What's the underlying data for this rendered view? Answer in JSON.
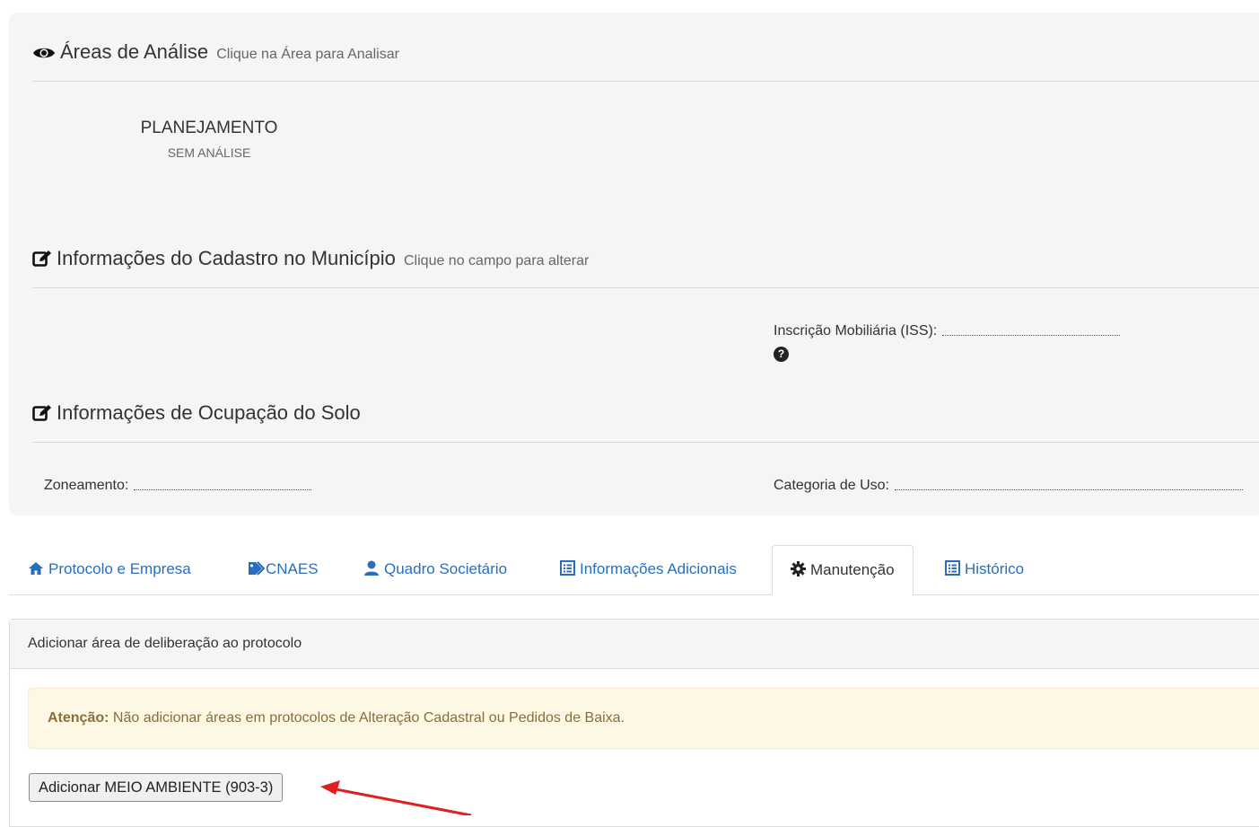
{
  "areas_section": {
    "icon": "eye-icon",
    "title": "Áreas de Análise",
    "subtitle": "Clique na Área para Analisar",
    "areas": [
      {
        "name": "PLANEJAMENTO",
        "status": "SEM ANÁLISE"
      }
    ]
  },
  "cadastro_section": {
    "icon": "edit-icon",
    "title": "Informações do Cadastro no Município",
    "subtitle": "Clique no campo para alterar",
    "inscricao_label": "Inscrição Mobiliária (ISS):",
    "inscricao_value": "",
    "help_icon": "question-circle-icon",
    "help_glyph": "?"
  },
  "solo_section": {
    "icon": "edit-icon",
    "title": "Informações de Ocupação do Solo",
    "zoneamento_label": "Zoneamento:",
    "zoneamento_value": "",
    "categoria_label": "Categoria de Uso:",
    "categoria_value": ""
  },
  "tabs": [
    {
      "label": "Protocolo e Empresa",
      "icon": "home-icon",
      "active": false
    },
    {
      "label": "CNAES",
      "icon": "tags-icon",
      "active": false
    },
    {
      "label": "Quadro Societário",
      "icon": "user-icon",
      "active": false
    },
    {
      "label": "Informações Adicionais",
      "icon": "list-alt-icon",
      "active": false
    },
    {
      "label": "Manutenção",
      "icon": "cog-icon",
      "active": true
    },
    {
      "label": "Histórico",
      "icon": "list-alt-icon",
      "active": false
    }
  ],
  "panel": {
    "heading": "Adicionar área de deliberação ao protocolo",
    "alert_strong": "Atenção:",
    "alert_text": " Não adicionar áreas em protocolos de Alteração Cadastral ou Pedidos de Baixa.",
    "button_label": "Adicionar MEIO AMBIENTE (903-3)"
  },
  "colors": {
    "link": "#2a6ebb",
    "well_bg": "#f5f5f5",
    "alert_bg": "#fcf8e3",
    "alert_text": "#8a6d3b",
    "annotation_arrow": "#e02020"
  }
}
